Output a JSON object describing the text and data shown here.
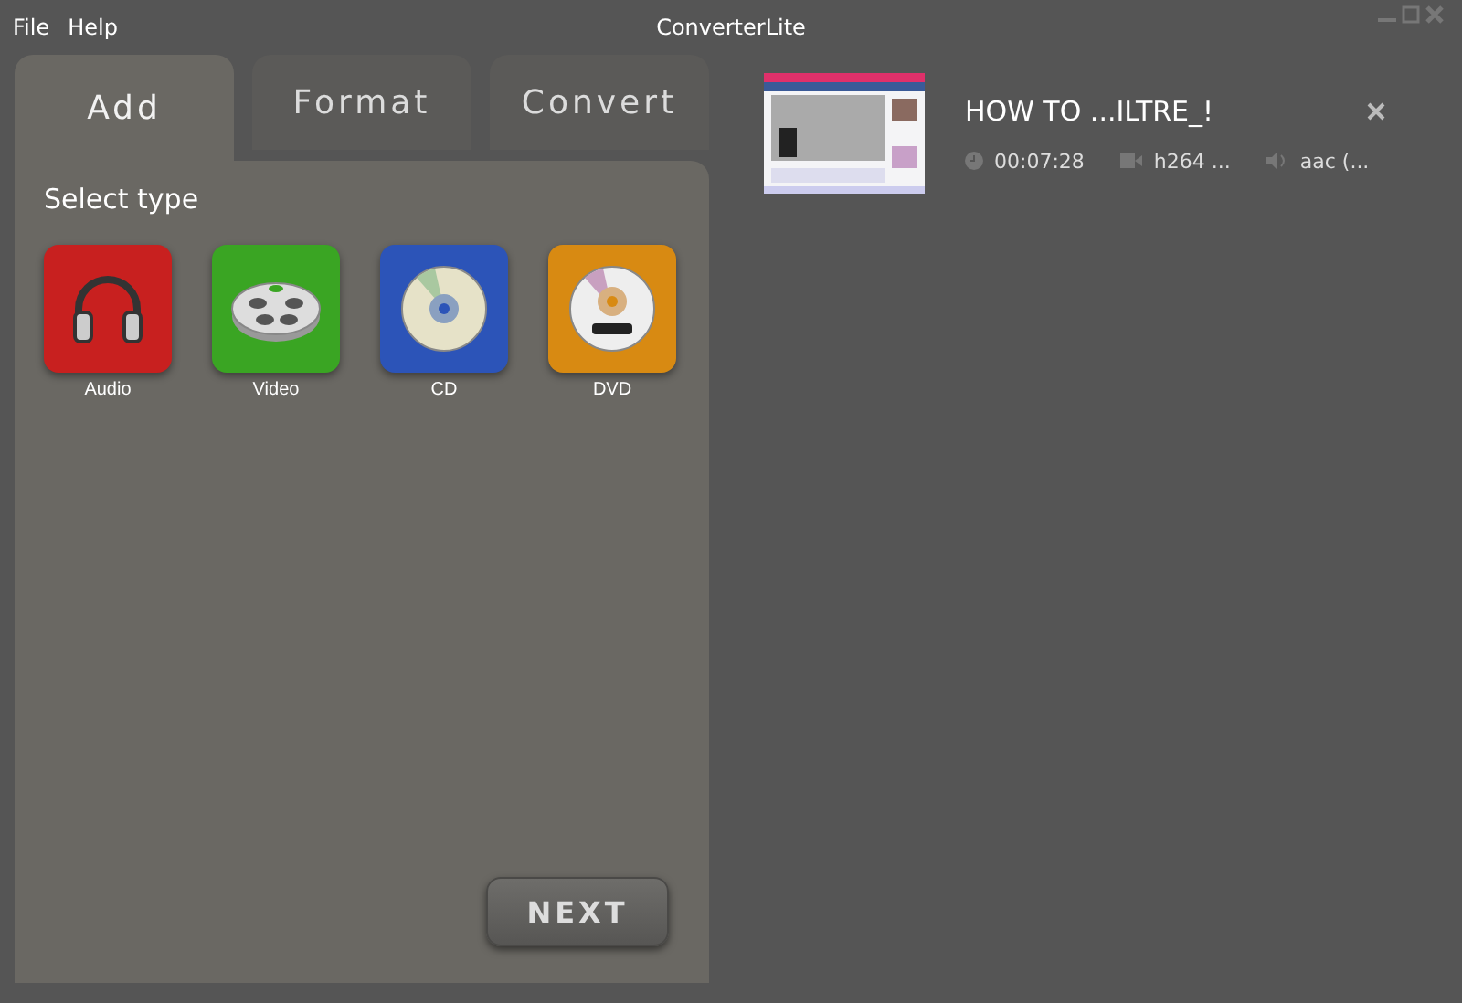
{
  "menu": [
    "File",
    "Help"
  ],
  "window": {
    "title": "ConverterLite"
  },
  "tabs": [
    {
      "label": "Add",
      "selected": true
    },
    {
      "label": "Format",
      "selected": false
    },
    {
      "label": "Convert",
      "selected": false
    }
  ],
  "panel": {
    "heading": "Select type",
    "types": [
      {
        "kind": "audio",
        "label": "Audio",
        "color": "#c8201f"
      },
      {
        "kind": "video",
        "label": "Video",
        "color": "#3aa523"
      },
      {
        "kind": "cd",
        "label": "CD",
        "color": "#2c54b8"
      },
      {
        "kind": "dvd",
        "label": "DVD",
        "color": "#d88a12"
      }
    ],
    "next_button": "NEXT"
  },
  "files": [
    {
      "kind": "picture",
      "title": "HOW TO ...ILTRE_!",
      "duration": "00:07:28",
      "video": "h264 ...",
      "audio": "aac (..."
    }
  ]
}
